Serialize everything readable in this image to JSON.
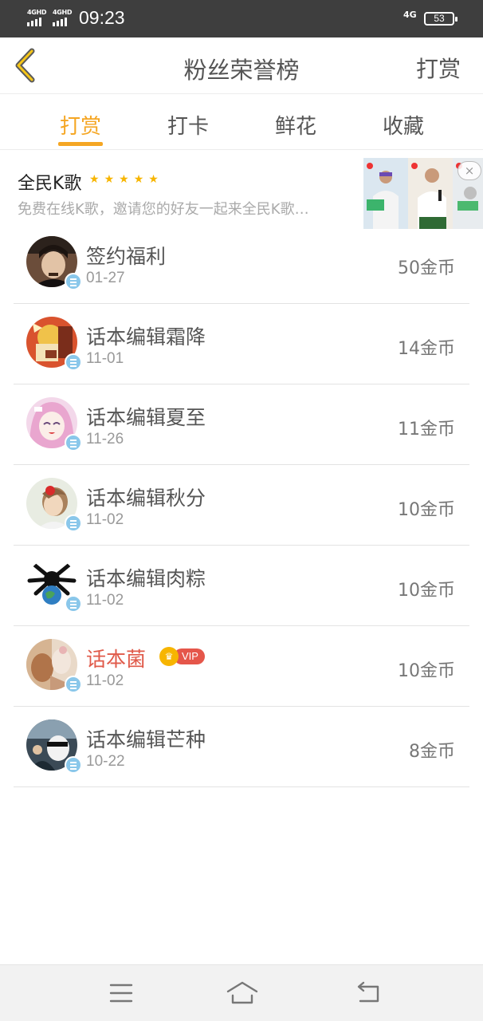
{
  "status_bar": {
    "signal1": "4GHD",
    "signal2": "4GHD",
    "time": "09:23",
    "network": "4G",
    "battery": "53"
  },
  "header": {
    "title": "粉丝荣誉榜",
    "action": "打赏"
  },
  "tabs": [
    {
      "label": "打赏",
      "active": true
    },
    {
      "label": "打卡",
      "active": false
    },
    {
      "label": "鲜花",
      "active": false
    },
    {
      "label": "收藏",
      "active": false
    }
  ],
  "ad": {
    "title": "全民K歌",
    "rating": 5,
    "description": "免费在线K歌，邀请您的好友一起来全民K歌…",
    "close_icon": "×"
  },
  "supporters": [
    {
      "name": "签约福利",
      "date": "01-27",
      "coins": "50金币"
    },
    {
      "name": "话本编辑霜降",
      "date": "11-01",
      "coins": "14金币"
    },
    {
      "name": "话本编辑夏至",
      "date": "11-26",
      "coins": "11金币"
    },
    {
      "name": "话本编辑秋分",
      "date": "11-02",
      "coins": "10金币"
    },
    {
      "name": "话本编辑肉粽",
      "date": "11-02",
      "coins": "10金币"
    },
    {
      "name": "话本菌",
      "date": "11-02",
      "coins": "10金币",
      "vip": "VIP"
    },
    {
      "name": "话本编辑芒种",
      "date": "10-22",
      "coins": "8金币"
    }
  ],
  "colors": {
    "accent": "#f5a623",
    "vip_name": "#e05a4a",
    "vip_badge": "#e5564a",
    "status_bar": "#3e3e3e"
  },
  "icons": {
    "back": "back-chevron-icon",
    "menu": "menu-icon",
    "home": "home-icon",
    "return": "return-icon"
  }
}
